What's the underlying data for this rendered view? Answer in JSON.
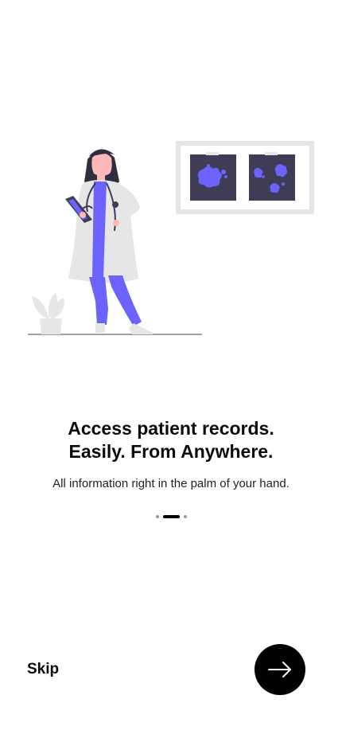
{
  "onboarding": {
    "title_line1": "Access patient records.",
    "title_line2": "Easily. From Anywhere.",
    "subtitle": "All information right in the palm of your hand.",
    "page_indicator": {
      "total": 3,
      "current": 2
    }
  },
  "actions": {
    "skip_label": "Skip",
    "next_icon": "arrow-right-icon"
  },
  "colors": {
    "accent": "#6c63ff",
    "dark": "#3f3d56",
    "coat": "#e6e6e6",
    "button": "#000000"
  }
}
